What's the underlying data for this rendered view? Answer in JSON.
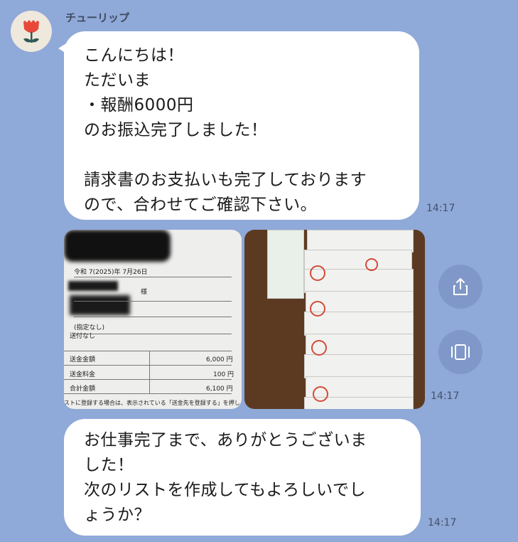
{
  "chat": {
    "sender_name": "チューリップ",
    "avatar_icon": "tulip-icon",
    "messages": [
      {
        "type": "text",
        "text": "こんにちは！\nただいま\n・報酬6000円\nのお振込完了しました！\n\n請求書のお支払いも完了しております\nので、合わせてご確認下さい。",
        "time": "14:17"
      },
      {
        "type": "images",
        "time": "14:17",
        "receipt": {
          "date": "令和 7(2025)年 7月26日",
          "honorific": "様",
          "designation": "(指定なし)",
          "shipping": "送付なし",
          "rows": [
            {
              "label": "送金金額",
              "value": "6,000 円"
            },
            {
              "label": "送金料金",
              "value": "100 円"
            },
            {
              "label": "合計金額",
              "value": "6,100 円"
            }
          ],
          "footer_note": "ストに登録する場合は、表示されている「送金先を登録する」を押し"
        }
      },
      {
        "type": "text",
        "text": "お仕事完了まで、ありがとうございま\nした！\n次のリストを作成してもよろしいでし\nょうか？",
        "time": "14:17"
      }
    ],
    "share_icon": "share-icon",
    "gallery_icon": "gallery-icon"
  },
  "colors": {
    "background": "#8fa9d8",
    "bubble": "#ffffff",
    "action_button": "#7f98c9",
    "tulip_red": "#e8483a",
    "tulip_leaf": "#2e5b57"
  }
}
